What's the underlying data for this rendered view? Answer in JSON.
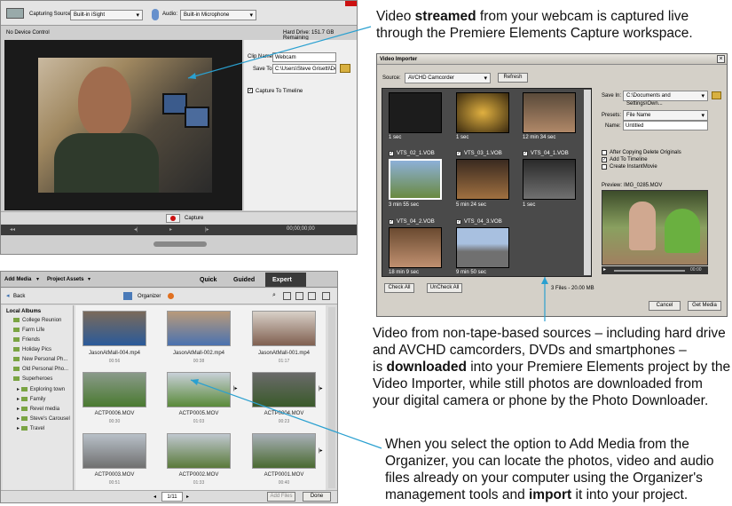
{
  "annotations": {
    "capture_a": "Video ",
    "capture_b": "streamed",
    "capture_c": " from your webcam is captured live",
    "capture_d": "through the Premiere Elements Capture workspace.",
    "importer_1": "Video from non-tape-based sources – including hard drive",
    "importer_2": "and AVCHD camcorders, DVDs and smartphones –",
    "importer_3a": "is ",
    "importer_3b": "downloaded",
    "importer_3c": " into your Premiere Elements project by the",
    "importer_4": "Video Importer, while still photos are downloaded from",
    "importer_5": "your digital camera or phone by the Photo Downloader.",
    "organizer_1": "When you select the option to Add Media from the",
    "organizer_2": "Organizer, you can locate the photos, video and audio",
    "organizer_3": "files already on your computer using the Organizer's",
    "organizer_4a": "management tools and ",
    "organizer_4b": "import",
    "organizer_4c": " it into your project."
  },
  "capture": {
    "capturing_source_label": "Capturing Source:",
    "source_value": "Built-in iSight",
    "audio_label": "Audio:",
    "audio_value": "Built-in Microphone",
    "device_control": "No Device Control",
    "hard_drive": "Hard Drive: 151.7 GB Remaining",
    "clip_name_label": "Clip Name:",
    "clip_name_value": "Webcam",
    "save_to_label": "Save To:",
    "save_to_value": "C:\\Users\\Steve Grisetti\\Docu",
    "capture_to_timeline": "Capture To Timeline",
    "capture_button": "Capture",
    "timecode": "00;00;00;00"
  },
  "importer": {
    "title": "Video Importer",
    "source_label": "Source:",
    "source_value": "AVCHD Camcorder",
    "refresh": "Refresh",
    "save_in_label": "Save In:",
    "save_in_value": "C:\\Documents and Settings\\Own...",
    "presets_label": "Presets:",
    "presets_value": "File Name",
    "name_label": "Name:",
    "name_value": "Untitled",
    "opt_delete": "After Copying Delete Originals",
    "opt_timeline": "Add To Timeline",
    "opt_instant": "Create InstantMovie",
    "preview_label": "Preview:",
    "preview_file": "IMG_0285.MOV",
    "preview_time": "00:00",
    "check_all": "Check All",
    "uncheck_all": "UnCheck All",
    "files_count": "3 Files - 20.00 MB",
    "cancel": "Cancel",
    "get_media": "Get Media",
    "clips": [
      {
        "name": "",
        "dur": "1 sec"
      },
      {
        "name": "",
        "dur": "1 sec"
      },
      {
        "name": "",
        "dur": "12 min 34 sec"
      },
      {
        "name": "VTS_02_1.VOB",
        "dur": "3 min 55 sec"
      },
      {
        "name": "VTS_03_1.VOB",
        "dur": "5 min 24 sec"
      },
      {
        "name": "VTS_04_1.VOB",
        "dur": "1 sec"
      },
      {
        "name": "VTS_04_2.VOB",
        "dur": "18 min 9 sec"
      },
      {
        "name": "VTS_04_3.VOB",
        "dur": "9 min 50 sec"
      }
    ]
  },
  "organizer": {
    "add_media": "Add Media",
    "project_assets": "Project Assets",
    "tab_quick": "Quick",
    "tab_guided": "Guided",
    "tab_expert": "Expert",
    "back": "Back",
    "title": "Organizer",
    "local_albums": "Local Albums",
    "albums": [
      "College Reunion",
      "Farm Life",
      "Friends",
      "Holiday Pics",
      "New Personal Ph...",
      "Old Personal Pho...",
      "Superheroes",
      "Exploring town",
      "Family",
      "Revel media",
      "Steve's Carousel",
      "Travel"
    ],
    "files": [
      {
        "name": "JasonAtMall-004.mp4",
        "time": "00:56"
      },
      {
        "name": "JasonAtMall-002.mp4",
        "time": "00:38"
      },
      {
        "name": "JasonAtMall-001.mp4",
        "time": "01:17"
      },
      {
        "name": "ACTP0006.MOV",
        "time": "00:30"
      },
      {
        "name": "ACTP0005.MOV",
        "time": "01:03"
      },
      {
        "name": "ACTP0004.MOV",
        "time": "00:23"
      },
      {
        "name": "ACTP0003.MOV",
        "time": "00:51"
      },
      {
        "name": "ACTP0002.MOV",
        "time": "01:33"
      },
      {
        "name": "ACTP0001.MOV",
        "time": "00:40"
      }
    ],
    "page": "1/11",
    "add_files": "Add Files",
    "done": "Done"
  },
  "colors": {
    "accent_red": "#cc1111",
    "pointer_blue": "#2aa0d0",
    "organizer_tab_dark": "#3a3a3a"
  }
}
